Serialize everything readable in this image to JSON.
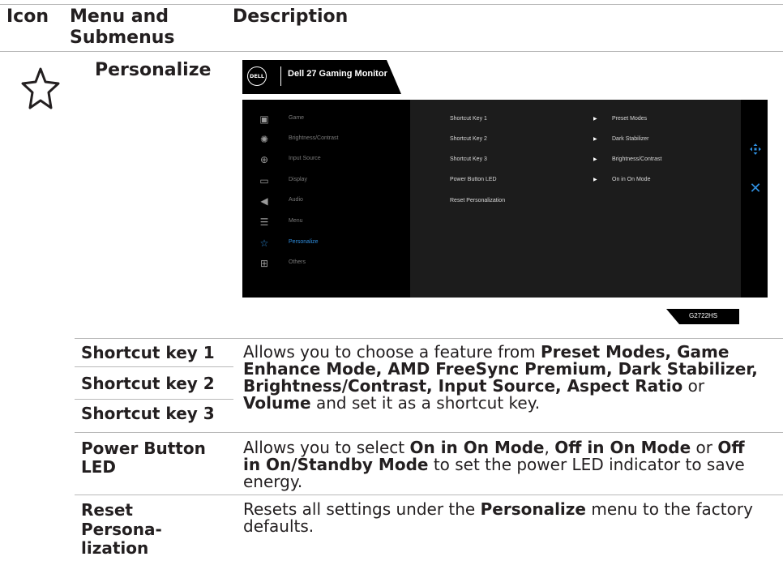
{
  "header": {
    "icon_col": "Icon",
    "menu_col_line1": "Menu and",
    "menu_col_line2": "Submenus",
    "desc_col": "Description"
  },
  "section": {
    "icon": "star-icon",
    "title": "Personalize"
  },
  "osd": {
    "logo": "DELL",
    "title": "Dell 27 Gaming Monitor",
    "menu": [
      {
        "icon": "game-icon",
        "glyph": "▣",
        "label": "Game",
        "active": false
      },
      {
        "icon": "brightness-icon",
        "glyph": "✺",
        "label": "Brightness/Contrast",
        "active": false
      },
      {
        "icon": "input-source-icon",
        "glyph": "⊕",
        "label": "Input Source",
        "active": false
      },
      {
        "icon": "display-icon",
        "glyph": "▭",
        "label": "Display",
        "active": false
      },
      {
        "icon": "audio-icon",
        "glyph": "◀",
        "label": "Audio",
        "active": false
      },
      {
        "icon": "menu-icon",
        "glyph": "☰",
        "label": "Menu",
        "active": false
      },
      {
        "icon": "star-icon",
        "glyph": "☆",
        "label": "Personalize",
        "active": true
      },
      {
        "icon": "others-icon",
        "glyph": "⊞",
        "label": "Others",
        "active": false
      }
    ],
    "options": [
      {
        "name": "Shortcut Key 1",
        "value": "Preset Modes"
      },
      {
        "name": "Shortcut Key 2",
        "value": "Dark Stabilizer"
      },
      {
        "name": "Shortcut Key 3",
        "value": "Brightness/Contrast"
      },
      {
        "name": "Power Button LED",
        "value": "On in On Mode"
      },
      {
        "name": "Reset Personalization",
        "value": ""
      }
    ],
    "nav_icon": "navigation-joystick-icon",
    "close_icon": "close-icon",
    "model": "G2722HS"
  },
  "rows": {
    "sk1": "Shortcut key 1",
    "sk2": "Shortcut key 2",
    "sk3": "Shortcut key 3",
    "sk_desc": {
      "p1": "Allows you to choose a feature from ",
      "b1": "Preset Modes, Game Enhance Mode, AMD FreeSync Premium, Dark Stabilizer, Brightness/Contrast, Input Source, Aspect Ratio",
      "p2": " or ",
      "b2": "Volume",
      "p3": " and set it as a shortcut key."
    },
    "pbl_line1": "Power Button",
    "pbl_line2": "LED",
    "pbl_desc": {
      "p1": "Allows you to select ",
      "b1": "On in On Mode",
      "p2": ", ",
      "b2": "Off in On Mode",
      "p3": " or ",
      "b3": "Off in On/Standby Mode",
      "p4": " to set the power LED indicator to save energy."
    },
    "reset_line1": "Reset",
    "reset_line2": "Persona-",
    "reset_line3": "lization",
    "reset_desc": {
      "p1": "Resets all settings under the ",
      "b1": "Personalize",
      "p2": " menu to the factory defaults."
    }
  }
}
